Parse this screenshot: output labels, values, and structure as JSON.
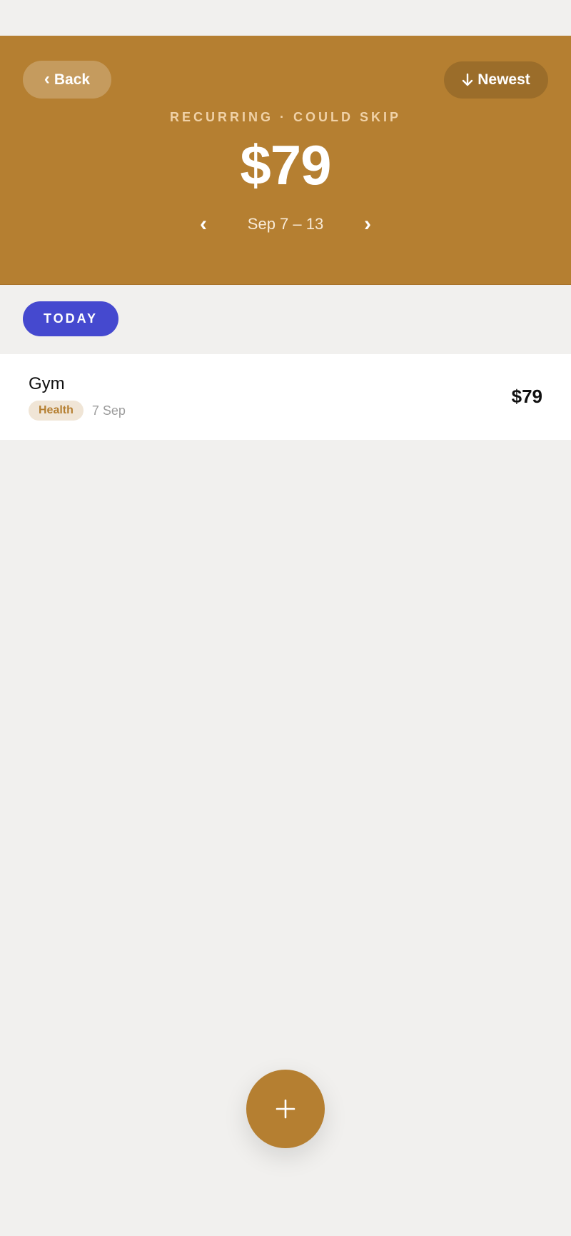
{
  "header": {
    "back_label": "Back",
    "sort_label": "Newest",
    "eyebrow": "RECURRING · COULD SKIP",
    "amount": "$79",
    "range": "Sep 7 – 13",
    "prev_icon": "‹",
    "next_icon": "›"
  },
  "filter": {
    "today_label": "TODAY"
  },
  "transactions": [
    {
      "title": "Gym",
      "category": "Health",
      "date": "7 Sep",
      "amount": "$79"
    }
  ],
  "fab": {
    "icon": "plus-icon"
  },
  "colors": {
    "accent": "#b57f31",
    "pill": "#4549cf",
    "background": "#f1f0ee"
  }
}
